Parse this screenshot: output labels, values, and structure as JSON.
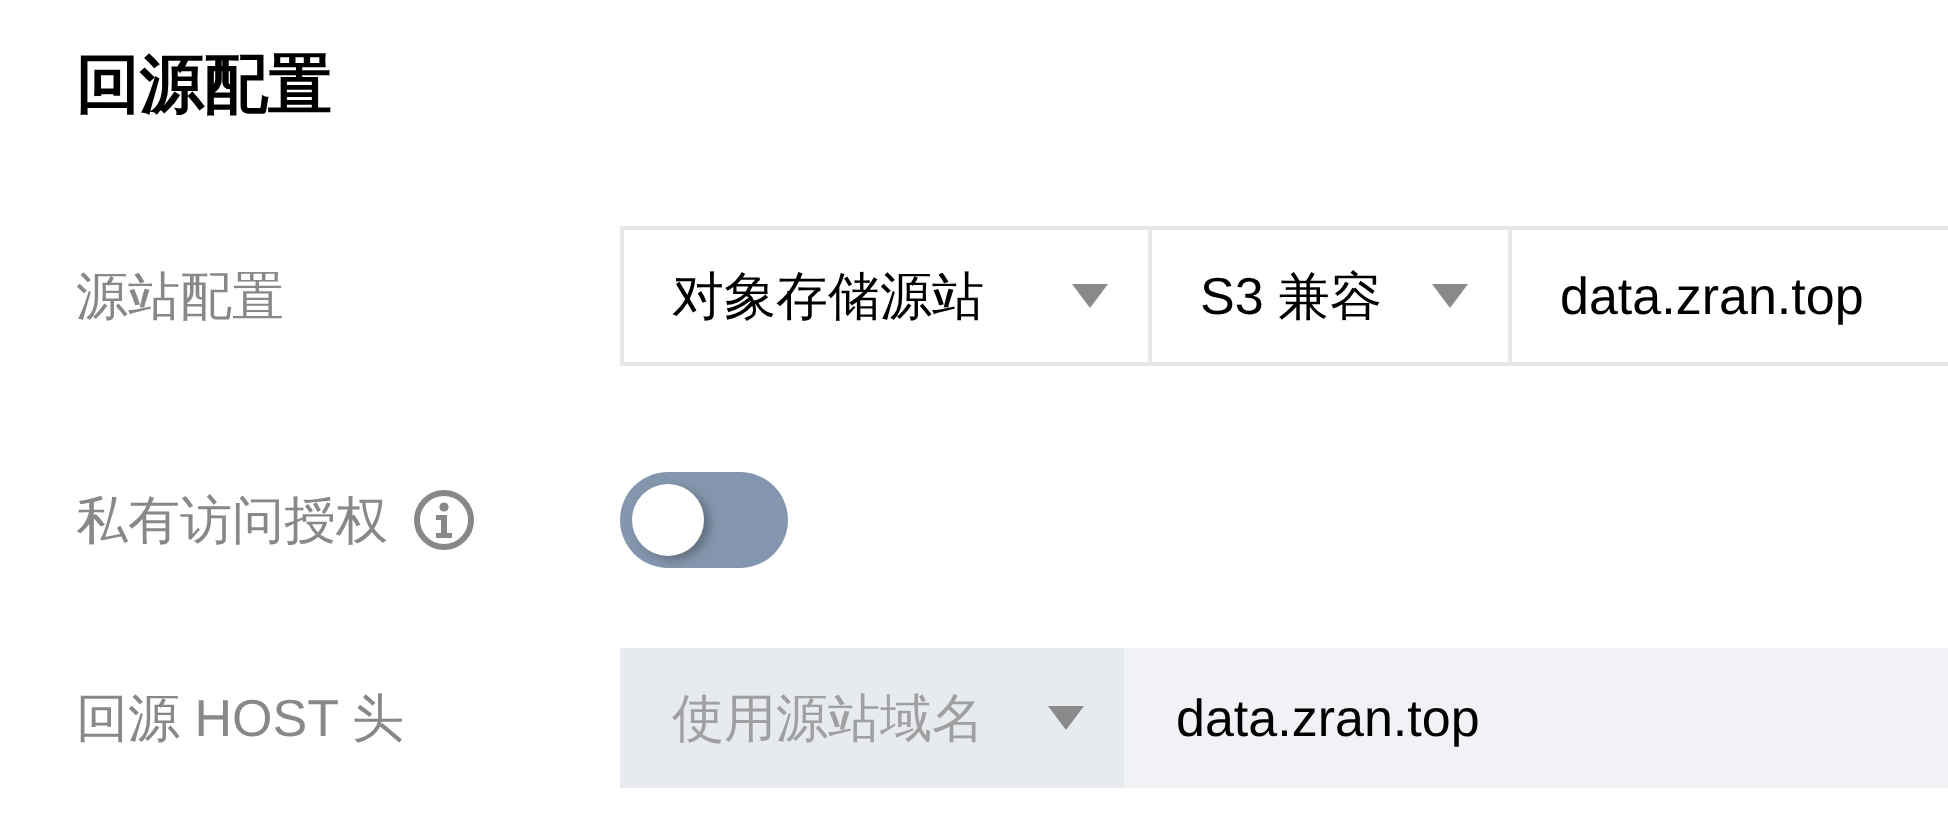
{
  "section_title": "回源配置",
  "rows": [
    {
      "kind": "origin",
      "label": "源站配置",
      "origin_type": {
        "value": "对象存储源站"
      },
      "compat": {
        "value": "S3 兼容"
      },
      "domain": {
        "value": "data.zran.top"
      }
    },
    {
      "kind": "toggle",
      "label": "私有访问授权",
      "info": true,
      "on": false
    },
    {
      "kind": "host",
      "label": "回源 HOST 头",
      "host_mode": {
        "value": "使用源站域名",
        "disabled": true
      },
      "host": {
        "value": "data.zran.top"
      }
    }
  ]
}
